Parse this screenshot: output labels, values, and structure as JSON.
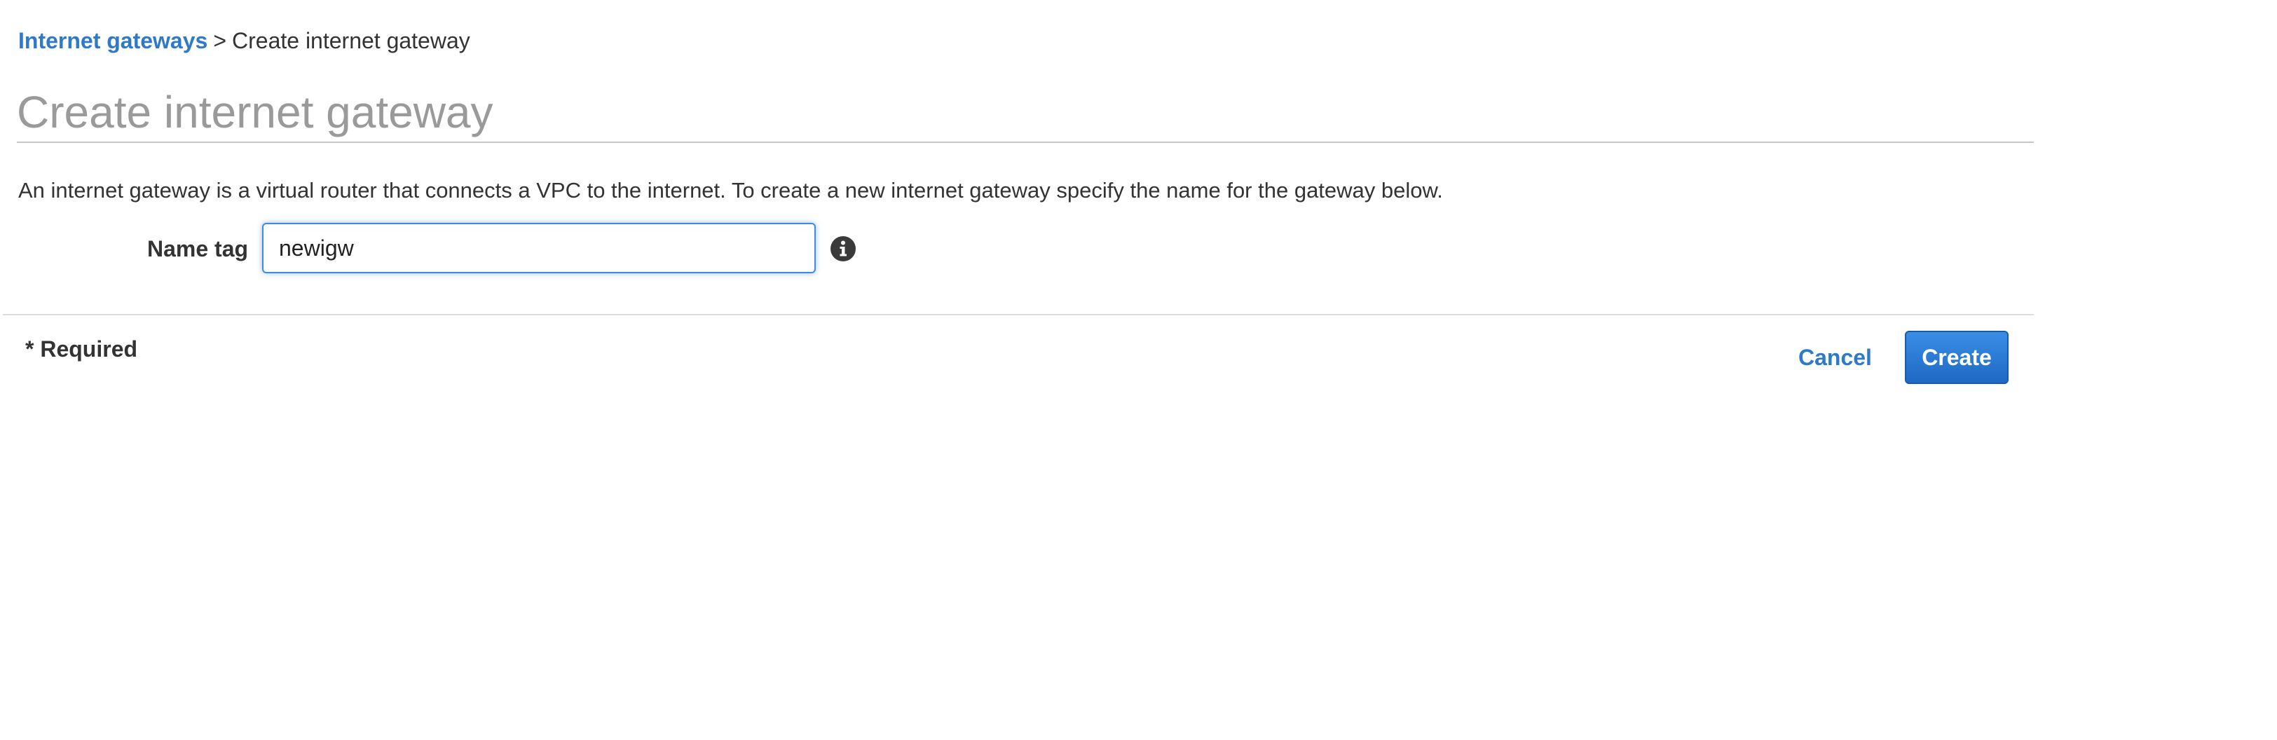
{
  "breadcrumb": {
    "parent_label": "Internet gateways",
    "separator": ">",
    "current_label": "Create internet gateway"
  },
  "page": {
    "title": "Create internet gateway",
    "description": "An internet gateway is a virtual router that connects a VPC to the internet. To create a new internet gateway specify the name for the gateway below."
  },
  "form": {
    "name_tag": {
      "label": "Name tag",
      "value": "newigw",
      "icon": "info-icon"
    }
  },
  "footer": {
    "required_note": "* Required",
    "cancel_label": "Cancel",
    "create_label": "Create"
  },
  "colors": {
    "link": "#2e7ac8",
    "primary_button": "#1d69c4",
    "title": "#9a9a9a",
    "input_focus_border": "#3f8ae0"
  }
}
